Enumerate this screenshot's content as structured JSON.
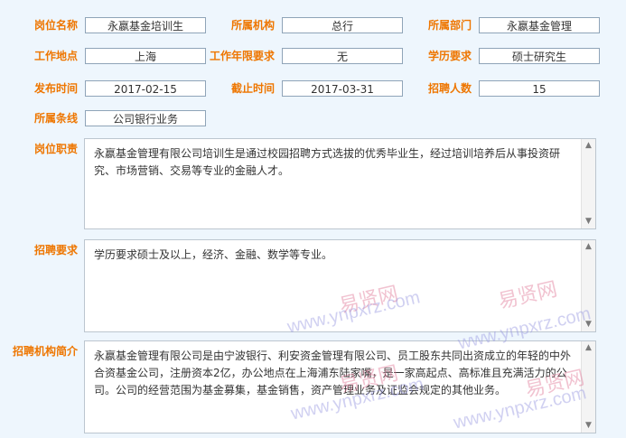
{
  "fields": {
    "position_name": {
      "label": "岗位名称",
      "value": "永嬴基金培训生"
    },
    "institution": {
      "label": "所属机构",
      "value": "总行"
    },
    "department": {
      "label": "所属部门",
      "value": "永嬴基金管理"
    },
    "work_location": {
      "label": "工作地点",
      "value": "上海"
    },
    "work_years": {
      "label": "工作年限要求",
      "value": "无"
    },
    "education": {
      "label": "学历要求",
      "value": "硕士研究生"
    },
    "publish_date": {
      "label": "发布时间",
      "value": "2017-02-15"
    },
    "deadline": {
      "label": "截止时间",
      "value": "2017-03-31"
    },
    "headcount": {
      "label": "招聘人数",
      "value": "15"
    },
    "business_line": {
      "label": "所属条线",
      "value": "公司银行业务"
    }
  },
  "sections": {
    "duties": {
      "label": "岗位职责",
      "text": "永嬴基金管理有限公司培训生是通过校园招聘方式选拔的优秀毕业生，经过培训培养后从事投资研究、市场营销、交易等专业的金融人才。"
    },
    "requirements": {
      "label": "招聘要求",
      "text": "学历要求硕士及以上，经济、金融、数学等专业。"
    },
    "org_intro": {
      "label": "招聘机构简介",
      "text": "永嬴基金管理有限公司是由宁波银行、利安资金管理有限公司、员工股东共同出资成立的年轻的中外合资基金公司，注册资本2亿，办公地点在上海浦东陆家嘴，是一家高起点、高标准且充满活力的公司。公司的经营范围为基金募集，基金销售，资产管理业务及证监会规定的其他业务。"
    }
  },
  "watermarks": {
    "cn": "易贤网",
    "url": "www.ynpxrz.com"
  },
  "scroll_icons": {
    "up": "arrow-up-icon",
    "down": "arrow-down-icon"
  }
}
